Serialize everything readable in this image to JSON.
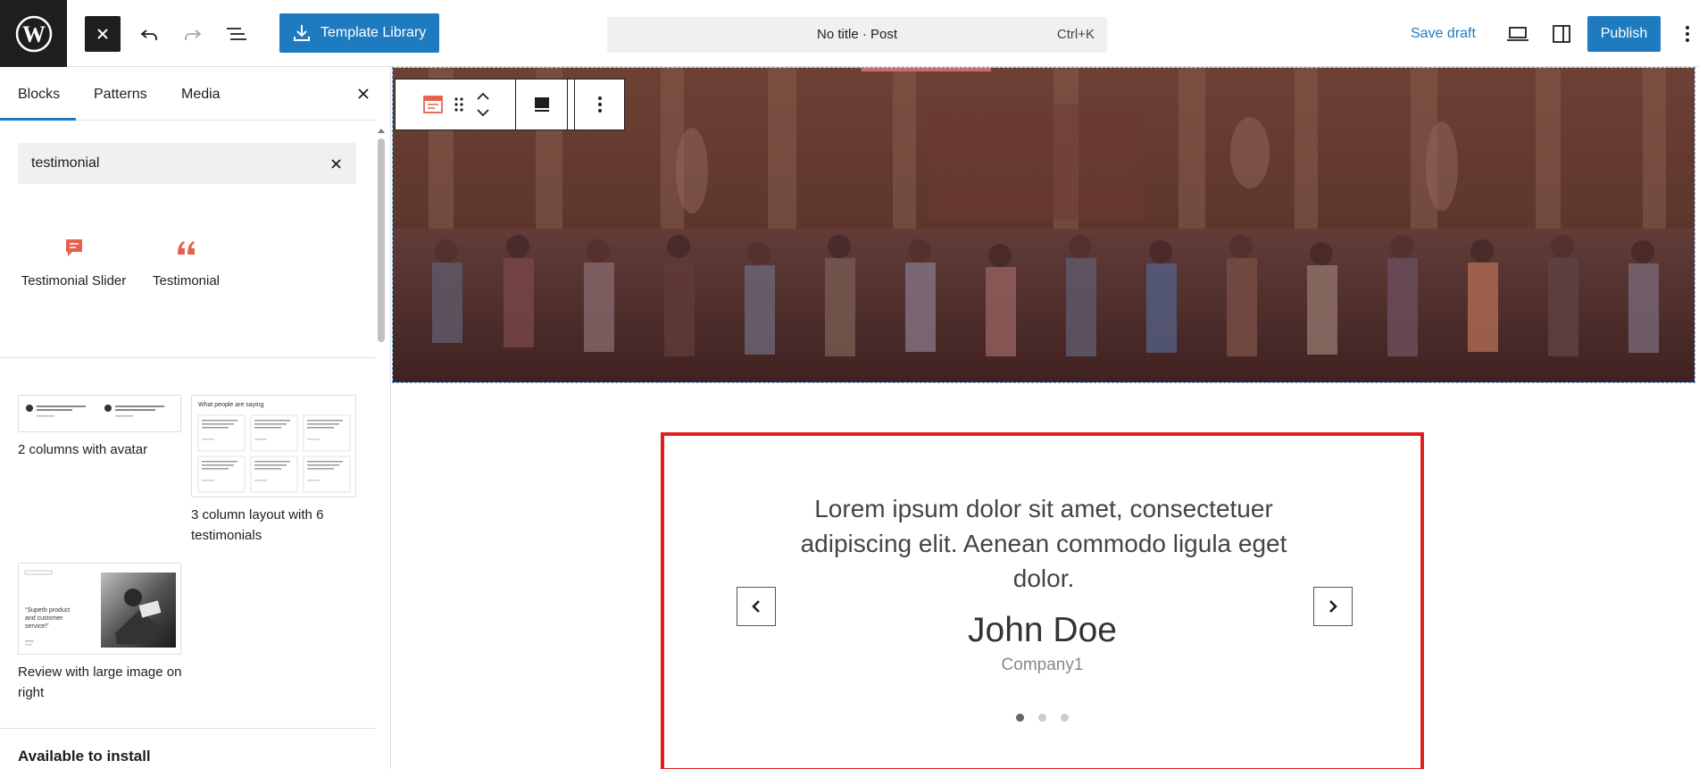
{
  "topbar": {
    "template_library_label": "Template Library",
    "document_title": "No title · Post",
    "shortcut": "Ctrl+K",
    "save_draft_label": "Save draft",
    "publish_label": "Publish"
  },
  "sidebar": {
    "tabs": [
      {
        "label": "Blocks"
      },
      {
        "label": "Patterns"
      },
      {
        "label": "Media"
      }
    ],
    "search": {
      "value": "testimonial"
    },
    "blocks": [
      {
        "label": "Testimonial Slider",
        "icon": "speech-bubble-icon"
      },
      {
        "label": "Testimonial",
        "icon": "quote-icon"
      }
    ],
    "patterns": [
      {
        "label": "2 columns with avatar"
      },
      {
        "label": "3 column layout with 6 testimonials",
        "thumb_heading": "What people are saying"
      },
      {
        "label": "Review with large image on right",
        "thumb_quote": "“Superb product and customer service!”"
      }
    ],
    "available_heading": "Available to install"
  },
  "canvas": {
    "testimonial": {
      "quote": "Lorem ipsum dolor sit amet, consectetuer adipiscing elit. Aenean commodo ligula eget dolor.",
      "author": "John Doe",
      "company": "Company1",
      "dots": 3,
      "active_dot": 0
    }
  },
  "colors": {
    "accent": "#1e7bbf",
    "block_icon": "#e8604c",
    "highlight_border": "#e02020"
  }
}
